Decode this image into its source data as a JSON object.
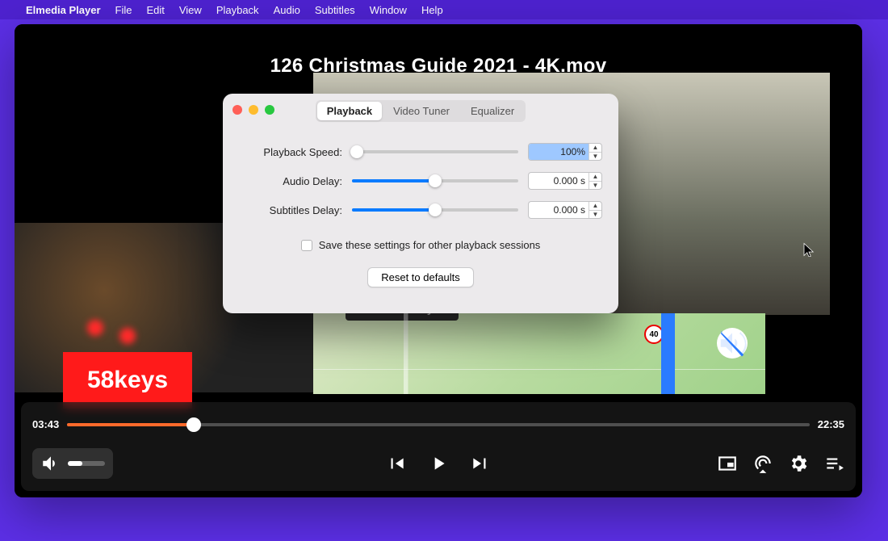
{
  "menubar": {
    "app_name": "Elmedia Player",
    "items": [
      "File",
      "Edit",
      "View",
      "Playback",
      "Audio",
      "Subtitles",
      "Window",
      "Help"
    ]
  },
  "player": {
    "video_title": "126 Christmas Guide 2021 - 4K.mov",
    "time_elapsed": "03:43",
    "time_total": "22:35",
    "progress_pct": 17,
    "volume_pct": 40,
    "overlay": {
      "redbox_text": "58keys",
      "nav_label": "Broadway",
      "speed_badge": "40"
    }
  },
  "settings": {
    "tabs": {
      "playback": "Playback",
      "video_tuner": "Video Tuner",
      "equalizer": "Equalizer"
    },
    "active_tab": "playback",
    "rows": {
      "speed": {
        "label": "Playback Speed:",
        "value": "100%",
        "slider_pct": 3
      },
      "audio": {
        "label": "Audio Delay:",
        "value": "0.000 s",
        "slider_pct": 50
      },
      "subtitles": {
        "label": "Subtitles Delay:",
        "value": "0.000 s",
        "slider_pct": 50
      }
    },
    "save_label": "Save these settings for other playback sessions",
    "save_checked": false,
    "reset_label": "Reset to defaults"
  }
}
